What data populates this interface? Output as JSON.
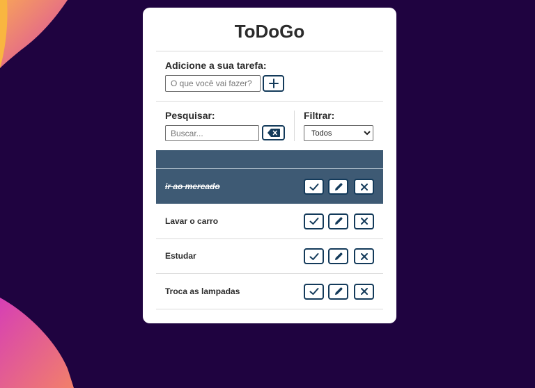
{
  "app": {
    "title": "ToDoGo"
  },
  "add": {
    "label": "Adicione a sua tarefa:",
    "placeholder": "O que você vai fazer?",
    "value": "",
    "button_icon": "plus-icon"
  },
  "search": {
    "label": "Pesquisar:",
    "placeholder": "Buscar...",
    "value": "",
    "clear_icon": "backspace-icon"
  },
  "filter": {
    "label": "Filtrar:",
    "selected": "Todos"
  },
  "todos": [
    {
      "title": "ir ao mercado",
      "done": true
    },
    {
      "title": "Lavar o carro",
      "done": false
    },
    {
      "title": "Estudar",
      "done": false
    },
    {
      "title": "Troca as lampadas",
      "done": false
    }
  ],
  "row_actions": [
    "check-icon",
    "pencil-icon",
    "close-icon"
  ],
  "colors": {
    "background": "#1f0340",
    "card": "#ffffff",
    "accent": "#133a5a",
    "done_row": "#3e5a74",
    "blob_orange": "#f7a35a",
    "blob_pink": "#d63fb5"
  }
}
